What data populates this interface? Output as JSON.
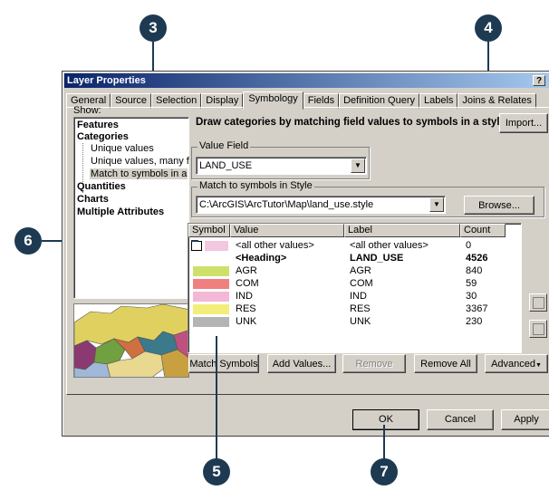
{
  "callouts": [
    "3",
    "4",
    "6",
    "5",
    "7"
  ],
  "window": {
    "title": "Layer Properties",
    "help": "?"
  },
  "tabs": [
    "General",
    "Source",
    "Selection",
    "Display",
    "Symbology",
    "Fields",
    "Definition Query",
    "Labels",
    "Joins & Relates"
  ],
  "show": {
    "label": "Show:",
    "items": [
      "Features",
      "Categories",
      "Unique values",
      "Unique values, many f",
      "Match to symbols in a",
      "Quantities",
      "Charts",
      "Multiple Attributes"
    ]
  },
  "header_text": "Draw categories by matching field values to symbols in a style.",
  "import_label": "Import...",
  "value_field": {
    "label": "Value Field",
    "value": "LAND_USE"
  },
  "style_group": {
    "label": "Match to symbols in Style",
    "path": "C:\\ArcGIS\\ArcTutor\\Map\\land_use.style",
    "browse": "Browse..."
  },
  "list": {
    "headers": [
      "Symbol",
      "Value",
      "Label",
      "Count"
    ],
    "rows": [
      {
        "value": "<all other values>",
        "label": "<all other values>",
        "count": "0",
        "color": "#f3c7e0",
        "bold": false
      },
      {
        "value": "<Heading>",
        "label": "LAND_USE",
        "count": "4526",
        "color": "",
        "bold": true
      },
      {
        "value": "AGR",
        "label": "AGR",
        "count": "840",
        "color": "#cfe06a",
        "bold": false
      },
      {
        "value": "COM",
        "label": "COM",
        "count": "59",
        "color": "#f08080",
        "bold": false
      },
      {
        "value": "IND",
        "label": "IND",
        "count": "30",
        "color": "#f3b8d6",
        "bold": false
      },
      {
        "value": "RES",
        "label": "RES",
        "count": "3367",
        "color": "#f3ee7a",
        "bold": false
      },
      {
        "value": "UNK",
        "label": "UNK",
        "count": "230",
        "color": "#b4b4b4",
        "bold": false
      }
    ]
  },
  "buttons": {
    "match_symbols": "Match Symbols",
    "add_values": "Add Values...",
    "remove": "Remove",
    "remove_all": "Remove All",
    "advanced": "Advanced",
    "ok": "OK",
    "cancel": "Cancel",
    "apply": "Apply"
  }
}
